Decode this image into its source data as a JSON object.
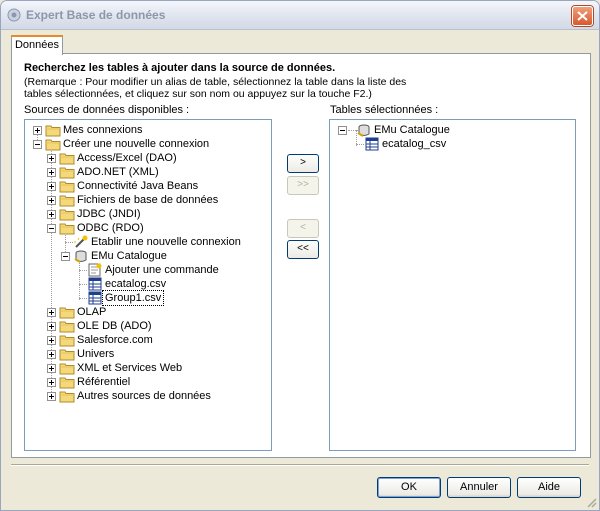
{
  "window": {
    "title": "Expert Base de données"
  },
  "tabs": [
    {
      "label": "Données"
    }
  ],
  "panel": {
    "heading": "Recherchez les tables à ajouter dans la source de données.",
    "note": "(Remarque : Pour modifier un alias de table, sélectionnez la table dans la liste des tables sélectionnées, et cliquez sur son nom ou appuyez sur la touche F2.)",
    "sources_label": "Sources de données disponibles :",
    "selected_label": "Tables sélectionnées :"
  },
  "tree": {
    "mes_connexions": "Mes connexions",
    "creer": "Créer une nouvelle connexion",
    "access_excel": "Access/Excel (DAO)",
    "ado_net": "ADO.NET (XML)",
    "java_beans": "Connectivité Java Beans",
    "fichiers": "Fichiers de base de données",
    "jdbc": "JDBC (JNDI)",
    "odbc": "ODBC (RDO)",
    "etablir": "Etablir une nouvelle connexion",
    "emu_catalogue": "EMu Catalogue",
    "ajouter_commande": "Ajouter une commande",
    "ecatalog": "ecatalog.csv",
    "group1": "Group1.csv",
    "olap": "OLAP",
    "ole_db": "OLE DB (ADO)",
    "salesforce": "Salesforce.com",
    "univers": "Univers",
    "xml_web": "XML et Services Web",
    "referentiel": "Référentiel",
    "autres": "Autres sources de données"
  },
  "selected_tree": {
    "emu_catalogue": "EMu Catalogue",
    "ecatalog_csv": "ecatalog_csv"
  },
  "move_buttons": {
    "add_one": ">",
    "add_all": ">>",
    "remove_one": "<",
    "remove_all": "<<"
  },
  "buttons": {
    "ok": "OK",
    "cancel": "Annuler",
    "help": "Aide"
  },
  "colors": {
    "folder": "#f4d97a",
    "close": "#d8582e",
    "tab_accent": "#e68b2c"
  }
}
